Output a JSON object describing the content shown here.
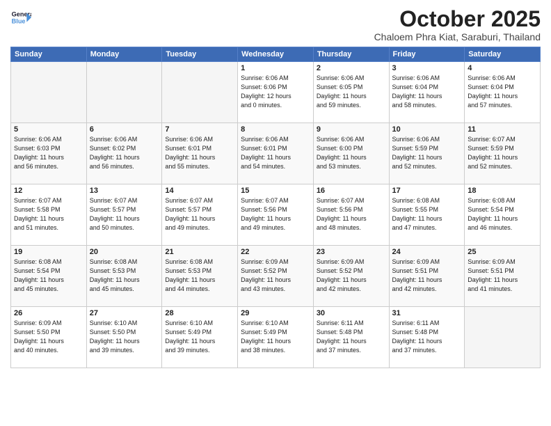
{
  "header": {
    "logo_line1": "General",
    "logo_line2": "Blue",
    "month": "October 2025",
    "location": "Chaloem Phra Kiat, Saraburi, Thailand"
  },
  "weekdays": [
    "Sunday",
    "Monday",
    "Tuesday",
    "Wednesday",
    "Thursday",
    "Friday",
    "Saturday"
  ],
  "weeks": [
    [
      {
        "day": "",
        "info": ""
      },
      {
        "day": "",
        "info": ""
      },
      {
        "day": "",
        "info": ""
      },
      {
        "day": "1",
        "info": "Sunrise: 6:06 AM\nSunset: 6:06 PM\nDaylight: 12 hours\nand 0 minutes."
      },
      {
        "day": "2",
        "info": "Sunrise: 6:06 AM\nSunset: 6:05 PM\nDaylight: 11 hours\nand 59 minutes."
      },
      {
        "day": "3",
        "info": "Sunrise: 6:06 AM\nSunset: 6:04 PM\nDaylight: 11 hours\nand 58 minutes."
      },
      {
        "day": "4",
        "info": "Sunrise: 6:06 AM\nSunset: 6:04 PM\nDaylight: 11 hours\nand 57 minutes."
      }
    ],
    [
      {
        "day": "5",
        "info": "Sunrise: 6:06 AM\nSunset: 6:03 PM\nDaylight: 11 hours\nand 56 minutes."
      },
      {
        "day": "6",
        "info": "Sunrise: 6:06 AM\nSunset: 6:02 PM\nDaylight: 11 hours\nand 56 minutes."
      },
      {
        "day": "7",
        "info": "Sunrise: 6:06 AM\nSunset: 6:01 PM\nDaylight: 11 hours\nand 55 minutes."
      },
      {
        "day": "8",
        "info": "Sunrise: 6:06 AM\nSunset: 6:01 PM\nDaylight: 11 hours\nand 54 minutes."
      },
      {
        "day": "9",
        "info": "Sunrise: 6:06 AM\nSunset: 6:00 PM\nDaylight: 11 hours\nand 53 minutes."
      },
      {
        "day": "10",
        "info": "Sunrise: 6:06 AM\nSunset: 5:59 PM\nDaylight: 11 hours\nand 52 minutes."
      },
      {
        "day": "11",
        "info": "Sunrise: 6:07 AM\nSunset: 5:59 PM\nDaylight: 11 hours\nand 52 minutes."
      }
    ],
    [
      {
        "day": "12",
        "info": "Sunrise: 6:07 AM\nSunset: 5:58 PM\nDaylight: 11 hours\nand 51 minutes."
      },
      {
        "day": "13",
        "info": "Sunrise: 6:07 AM\nSunset: 5:57 PM\nDaylight: 11 hours\nand 50 minutes."
      },
      {
        "day": "14",
        "info": "Sunrise: 6:07 AM\nSunset: 5:57 PM\nDaylight: 11 hours\nand 49 minutes."
      },
      {
        "day": "15",
        "info": "Sunrise: 6:07 AM\nSunset: 5:56 PM\nDaylight: 11 hours\nand 49 minutes."
      },
      {
        "day": "16",
        "info": "Sunrise: 6:07 AM\nSunset: 5:56 PM\nDaylight: 11 hours\nand 48 minutes."
      },
      {
        "day": "17",
        "info": "Sunrise: 6:08 AM\nSunset: 5:55 PM\nDaylight: 11 hours\nand 47 minutes."
      },
      {
        "day": "18",
        "info": "Sunrise: 6:08 AM\nSunset: 5:54 PM\nDaylight: 11 hours\nand 46 minutes."
      }
    ],
    [
      {
        "day": "19",
        "info": "Sunrise: 6:08 AM\nSunset: 5:54 PM\nDaylight: 11 hours\nand 45 minutes."
      },
      {
        "day": "20",
        "info": "Sunrise: 6:08 AM\nSunset: 5:53 PM\nDaylight: 11 hours\nand 45 minutes."
      },
      {
        "day": "21",
        "info": "Sunrise: 6:08 AM\nSunset: 5:53 PM\nDaylight: 11 hours\nand 44 minutes."
      },
      {
        "day": "22",
        "info": "Sunrise: 6:09 AM\nSunset: 5:52 PM\nDaylight: 11 hours\nand 43 minutes."
      },
      {
        "day": "23",
        "info": "Sunrise: 6:09 AM\nSunset: 5:52 PM\nDaylight: 11 hours\nand 42 minutes."
      },
      {
        "day": "24",
        "info": "Sunrise: 6:09 AM\nSunset: 5:51 PM\nDaylight: 11 hours\nand 42 minutes."
      },
      {
        "day": "25",
        "info": "Sunrise: 6:09 AM\nSunset: 5:51 PM\nDaylight: 11 hours\nand 41 minutes."
      }
    ],
    [
      {
        "day": "26",
        "info": "Sunrise: 6:09 AM\nSunset: 5:50 PM\nDaylight: 11 hours\nand 40 minutes."
      },
      {
        "day": "27",
        "info": "Sunrise: 6:10 AM\nSunset: 5:50 PM\nDaylight: 11 hours\nand 39 minutes."
      },
      {
        "day": "28",
        "info": "Sunrise: 6:10 AM\nSunset: 5:49 PM\nDaylight: 11 hours\nand 39 minutes."
      },
      {
        "day": "29",
        "info": "Sunrise: 6:10 AM\nSunset: 5:49 PM\nDaylight: 11 hours\nand 38 minutes."
      },
      {
        "day": "30",
        "info": "Sunrise: 6:11 AM\nSunset: 5:48 PM\nDaylight: 11 hours\nand 37 minutes."
      },
      {
        "day": "31",
        "info": "Sunrise: 6:11 AM\nSunset: 5:48 PM\nDaylight: 11 hours\nand 37 minutes."
      },
      {
        "day": "",
        "info": ""
      }
    ]
  ]
}
